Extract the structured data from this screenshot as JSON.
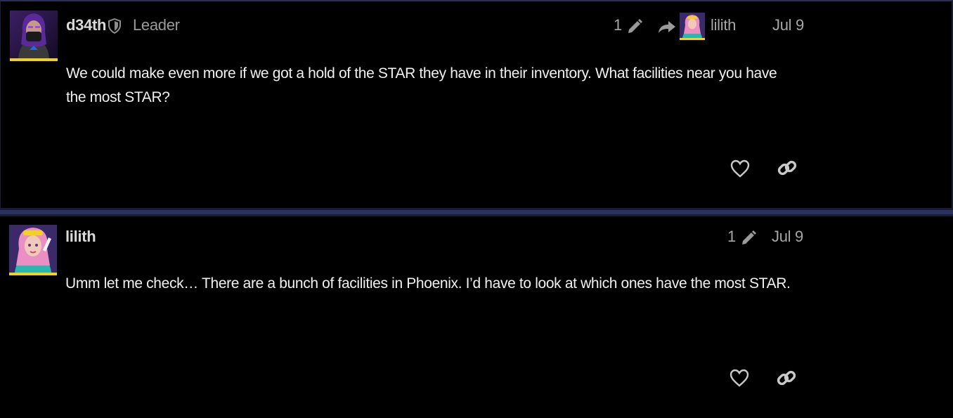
{
  "posts": [
    {
      "username": "d34th",
      "role": "Leader",
      "edit_count": "1",
      "reply_to": "lilith",
      "date": "Jul 9",
      "body": "We could make even more if we got a hold of the STAR they have in their inventory. What facilities near you have the most STAR?"
    },
    {
      "username": "lilith",
      "edit_count": "1",
      "date": "Jul 9",
      "body": "Umm let me check… There are a bunch of facilities in Phoenix. I’d have to look at which ones have the most STAR."
    }
  ],
  "icons": {
    "moderator": "shield-icon",
    "edit": "pencil-icon",
    "reply": "reply-arrow-icon",
    "like": "heart-icon",
    "share": "link-icon"
  },
  "colors": {
    "background": "#000000",
    "divider": "#2b3263",
    "avatar_underline": "#f2d31a",
    "muted_text": "#a7a7a7"
  }
}
